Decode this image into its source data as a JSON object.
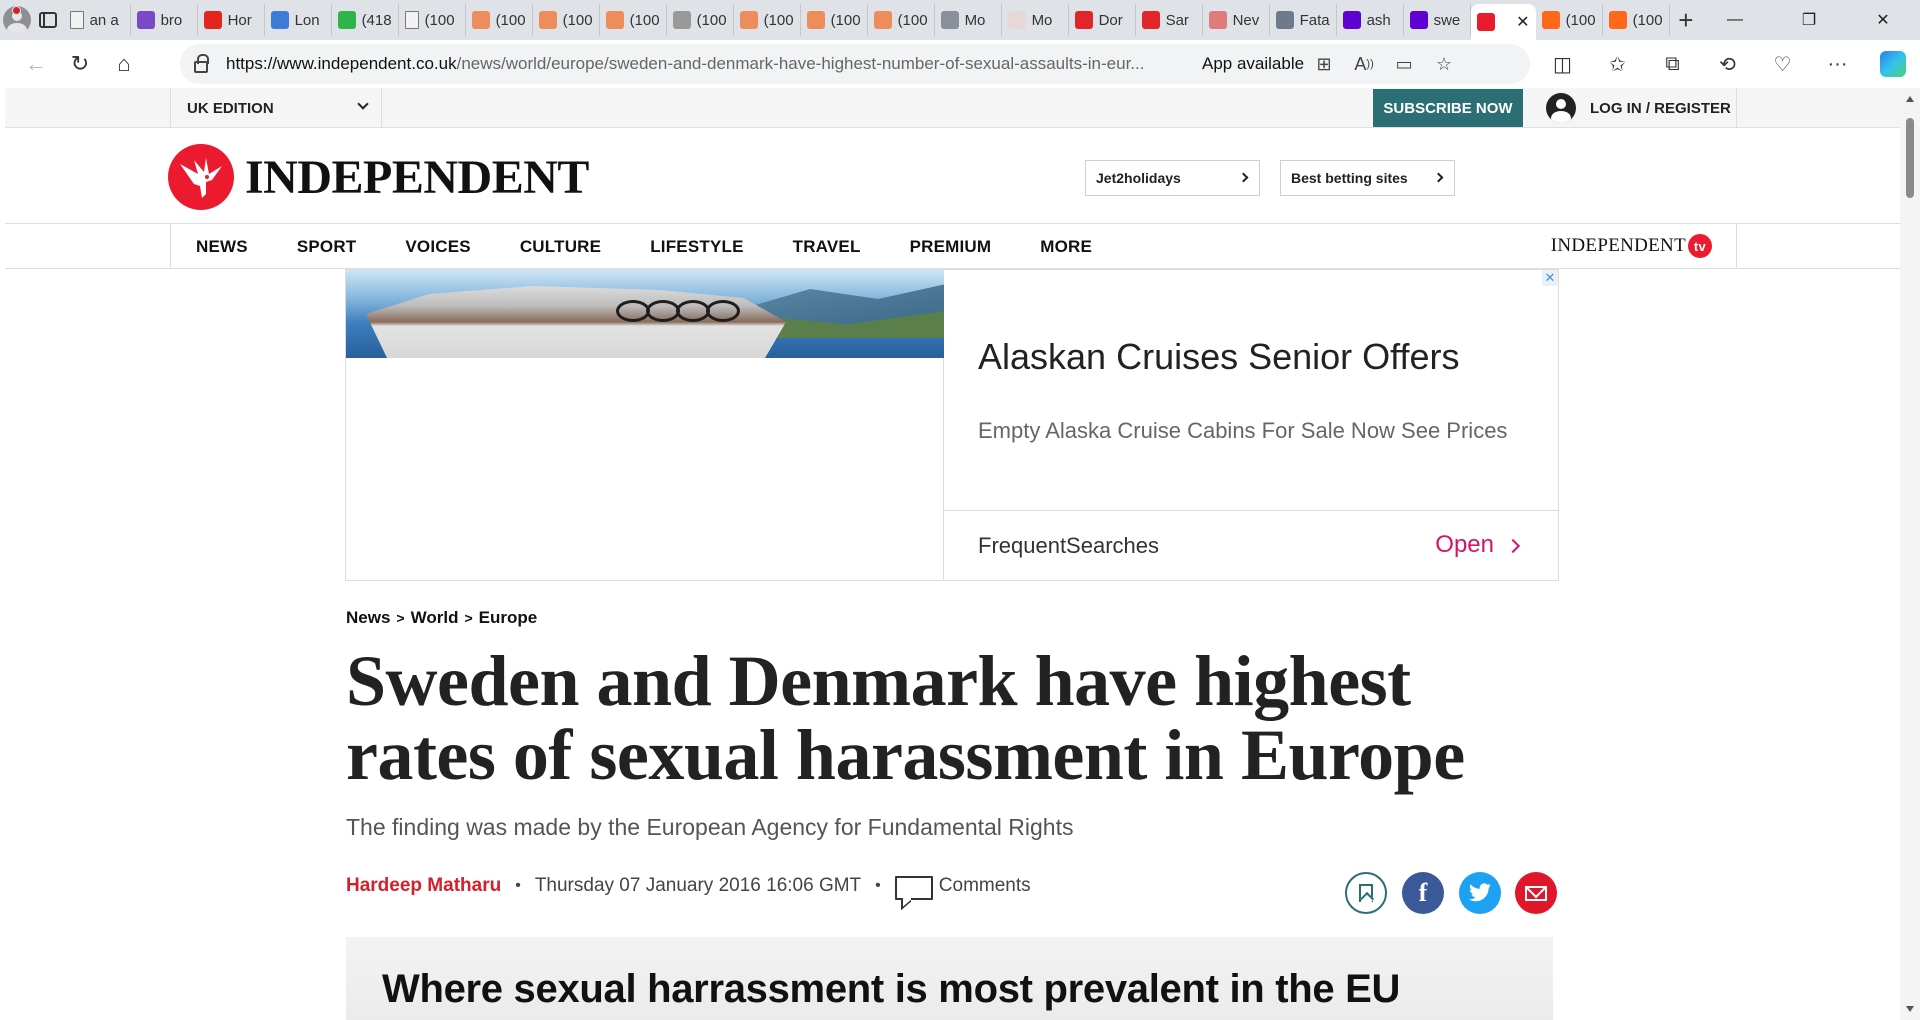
{
  "browser": {
    "tabs": [
      {
        "label": "an a",
        "favicon": "page-icon",
        "color": "#f2f2f2"
      },
      {
        "label": "bro",
        "favicon": "yahoo-icon",
        "color": "#7b48c7"
      },
      {
        "label": "Hor",
        "favicon": "red-shield-icon",
        "color": "#e2251e"
      },
      {
        "label": "Lon",
        "favicon": "five-icon",
        "color": "#3d7bd6"
      },
      {
        "label": "(418",
        "favicon": "g-icon",
        "color": "#2fb34a"
      },
      {
        "label": "(100",
        "favicon": "page-icon",
        "color": "#f2f2f2"
      },
      {
        "label": "(100",
        "favicon": "substack-icon",
        "color": "#ee8d5c"
      },
      {
        "label": "(100",
        "favicon": "substack-icon",
        "color": "#ee8d5c"
      },
      {
        "label": "(100",
        "favicon": "substack-icon",
        "color": "#ee8d5c"
      },
      {
        "label": "(100",
        "favicon": "avatar-icon",
        "color": "#999999"
      },
      {
        "label": "(100",
        "favicon": "substack-icon",
        "color": "#ee8d5c"
      },
      {
        "label": "(100",
        "favicon": "substack-icon",
        "color": "#ee8d5c"
      },
      {
        "label": "(100",
        "favicon": "substack-icon",
        "color": "#ee8d5c"
      },
      {
        "label": "Mo",
        "favicon": "wordpress-icon",
        "color": "#8a9099"
      },
      {
        "label": "Mo",
        "favicon": "bi-icon",
        "color": "#e7d9d9"
      },
      {
        "label": "Dor",
        "favicon": "youtube-icon",
        "color": "#e0252b"
      },
      {
        "label": "Sar",
        "favicon": "youtube-icon",
        "color": "#e0252b"
      },
      {
        "label": "Nev",
        "favicon": "r-icon",
        "color": "#e07b7b"
      },
      {
        "label": "Fata",
        "favicon": "arrow-icon",
        "color": "#6e7a8c"
      },
      {
        "label": "ash",
        "favicon": "yahoo-icon",
        "color": "#5f01d1"
      },
      {
        "label": "swe",
        "favicon": "yahoo-icon",
        "color": "#5f01d1"
      },
      {
        "label": "",
        "favicon": "independent-icon",
        "color": "#ec1a2e",
        "active": true
      },
      {
        "label": "(100",
        "favicon": "substack-icon",
        "color": "#ff6719"
      },
      {
        "label": "(100",
        "favicon": "substack-icon",
        "color": "#ff6719"
      }
    ],
    "url_host": "https://www.independent.co.uk",
    "url_path": "/news/world/europe/sweden-and-denmark-have-highest-number-of-sexual-assaults-in-eur...",
    "app_available": "App available"
  },
  "site": {
    "edition": "UK EDITION",
    "subscribe": "SUBSCRIBE NOW",
    "login": "LOG IN / REGISTER",
    "logo": "INDEPENDENT",
    "promos": [
      "Jet2holidays",
      "Best betting sites"
    ],
    "nav": [
      "NEWS",
      "SPORT",
      "VOICES",
      "CULTURE",
      "LIFESTYLE",
      "TRAVEL",
      "PREMIUM",
      "MORE"
    ],
    "tv_logo": "INDEPENDENT",
    "tv_badge": "tv",
    "accent": "#ec1a2e",
    "subscribe_color": "#2b6e74"
  },
  "ad": {
    "title": "Alaskan Cruises Senior Offers",
    "description": "Empty Alaska Cruise Cabins For Sale Now See Prices",
    "source": "FrequentSearches",
    "cta": "Open",
    "close": "✕"
  },
  "article": {
    "breadcrumb": [
      "News",
      "World",
      "Europe"
    ],
    "breadcrumb_sep": ">",
    "headline": "Sweden and Denmark have highest rates of sexual harassment in Europe",
    "standfirst": "The finding was made by the European Agency for Fundamental Rights",
    "author": "Hardeep Matharu",
    "date": "Thursday 07 January 2016 16:06 GMT",
    "comments": "Comments",
    "figure_title": "Where sexual harrassment is most prevalent in the EU"
  }
}
